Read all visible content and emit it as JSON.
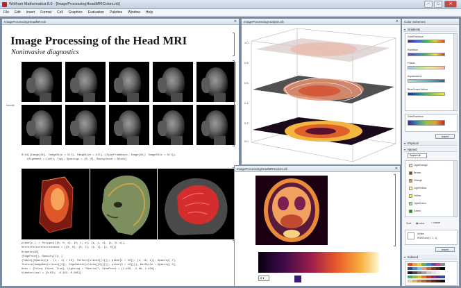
{
  "window": {
    "title": "Wolfram Mathematica 8.0 - [ImageProcessingHeadMRIColors.nb]",
    "minimize": "–",
    "maximize": "□",
    "close": "✕"
  },
  "menu": [
    "File",
    "Edit",
    "Insert",
    "Format",
    "Cell",
    "Graphics",
    "Evaluation",
    "Palettes",
    "Window",
    "Help"
  ],
  "notebook_main": {
    "tab_title": "ImageProcessingHeadMRI.nb",
    "heading": "Image Processing of the Head MRI",
    "subtitle": "Noninvasive diagnostics",
    "side_link": "handle",
    "code_line_1": "Grid[{Image[#k], ImageSize = All], ImageSize = All}, {SpanFromAbove, Image[#k], ImageSize = All}},",
    "code_line_2": "Alignment = {Left, Top}, Spacings = {0, 0}, Background = Black]",
    "code_block": [
      "plane[z_] := Polygon[{{0, 0, z}, {0, 1, z}, {1, 1, z}, {1, 0, z}},",
      "   VertexTextureCoordinates = {{0, 0}, {0, 1}, {1, 1}, {1, 0}}]",
      "Graphics3D[",
      "  {EdgeForm[], Opacity[1], {",
      "   {Table[{Opacity[1 - (i - 1) / 10], Texture[slices[[i]]], plane[i / 10]}, {i, 10, 1}], Opacity[.7],",
      "    Texture[ImageAdd[slices[[3]], EdgeDetect[slices[[3]]]]], plane[3 / 10]}}}, BoxStyle = Opacity[.5],",
      "  Axes = {False, False, True}, Lighting = \"Neutral\", ViewPoint = {1.458, -2.66, 1.458},",
      "  ViewVertical = {0.074, -0.153, 0.985}]"
    ]
  },
  "notebook_analysis": {
    "tab_title": "ImageProcessingAnalysis.nb",
    "axis_ticks": [
      "1.0",
      "0.8",
      "0.6",
      "0.4",
      "0.2",
      "0.0"
    ]
  },
  "notebook_colors": {
    "tab_title": "ImageProcessingHeadMRIColors.nb",
    "dropdown_value": "8"
  },
  "color_schemes": {
    "title": "Color Schemes",
    "gradients_header": "Gradients",
    "gradients": [
      "DarkRainbow",
      "Rainbow",
      "Pastel",
      "Aquamarine",
      "BlueGreenYellow"
    ],
    "second_box_title": "DarkRainbow",
    "insert_label": "Insert",
    "physical_header": "Physical",
    "named_header": "Named",
    "named_dropdown": "System",
    "named_colors": [
      {
        "label": "LightOrange",
        "color": "#fde0c0"
      },
      {
        "label": "Brown",
        "color": "#8b4513"
      },
      {
        "label": "Orange",
        "color": "#ff8c00"
      },
      {
        "label": "LightYellow",
        "color": "#ffffc8"
      },
      {
        "label": "Yellow",
        "color": "#ffff00"
      },
      {
        "label": "LightGreen",
        "color": "#90ee90"
      },
      {
        "label": "Green",
        "color": "#00a000"
      }
    ],
    "sort_label": "Sort",
    "sort_opt_1": "color",
    "sort_opt_2": "name",
    "white_box_line_1": "White",
    "white_box_line_2": "RGBColor[1, 1, 1]",
    "insert_label_2": "Insert",
    "indexed_header": "Indexed"
  },
  "colors": {
    "accent": "#2f62b8",
    "close_red": "#c9463d",
    "frame": "#7f8fa3"
  }
}
